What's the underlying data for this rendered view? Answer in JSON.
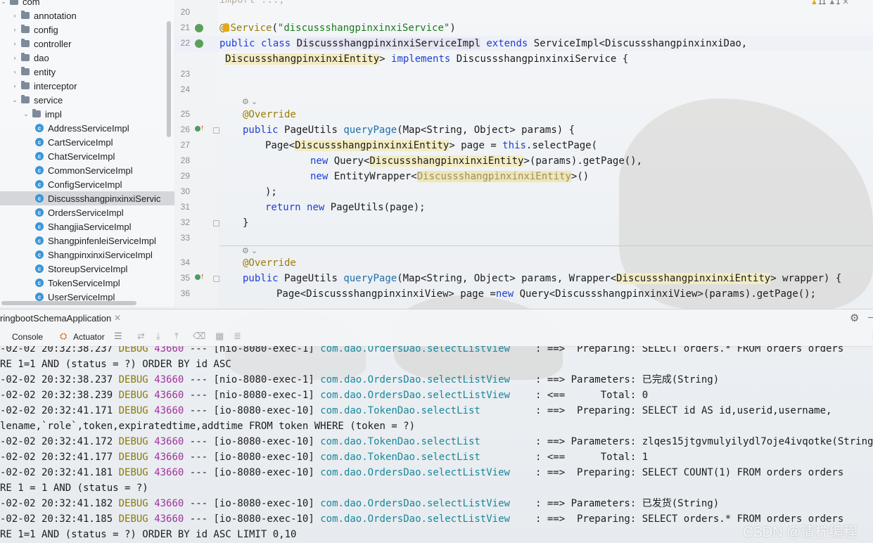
{
  "tree": {
    "items": [
      {
        "label": "com",
        "kind": "folder",
        "depth": 0,
        "expanded": true
      },
      {
        "label": "annotation",
        "kind": "folder",
        "depth": 1,
        "expanded": false
      },
      {
        "label": "config",
        "kind": "folder",
        "depth": 1,
        "expanded": false
      },
      {
        "label": "controller",
        "kind": "folder",
        "depth": 1,
        "expanded": false
      },
      {
        "label": "dao",
        "kind": "folder",
        "depth": 1,
        "expanded": false
      },
      {
        "label": "entity",
        "kind": "folder",
        "depth": 1,
        "expanded": false
      },
      {
        "label": "interceptor",
        "kind": "folder",
        "depth": 1,
        "expanded": false
      },
      {
        "label": "service",
        "kind": "folder",
        "depth": 1,
        "expanded": true
      },
      {
        "label": "impl",
        "kind": "folder",
        "depth": 2,
        "expanded": true
      },
      {
        "label": "AddressServiceImpl",
        "kind": "class",
        "depth": 3
      },
      {
        "label": "CartServiceImpl",
        "kind": "class",
        "depth": 3
      },
      {
        "label": "ChatServiceImpl",
        "kind": "class",
        "depth": 3
      },
      {
        "label": "CommonServiceImpl",
        "kind": "class",
        "depth": 3
      },
      {
        "label": "ConfigServiceImpl",
        "kind": "class",
        "depth": 3
      },
      {
        "label": "DiscussshangpinxinxiServic",
        "kind": "class",
        "depth": 3,
        "selected": true
      },
      {
        "label": "OrdersServiceImpl",
        "kind": "class",
        "depth": 3
      },
      {
        "label": "ShangjiaServiceImpl",
        "kind": "class",
        "depth": 3
      },
      {
        "label": "ShangpinfenleiServiceImpl",
        "kind": "class",
        "depth": 3
      },
      {
        "label": "ShangpinxinxiServiceImpl",
        "kind": "class",
        "depth": 3
      },
      {
        "label": "StoreupServiceImpl",
        "kind": "class",
        "depth": 3
      },
      {
        "label": "TokenServiceImpl",
        "kind": "class",
        "depth": 3
      },
      {
        "label": "UserServiceImpl",
        "kind": "class",
        "depth": 3
      }
    ]
  },
  "editor": {
    "line_numbers": [
      "20",
      "21",
      "22",
      "23",
      "24",
      "25",
      "26",
      "27",
      "28",
      "29",
      "30",
      "31",
      "32",
      "33",
      "34",
      "35",
      "36"
    ],
    "top_cut_text": "import ...;",
    "inspection": {
      "warnings": "11",
      "weak": "1"
    },
    "code": {
      "l21_at": "@",
      "l21_ann": "Service",
      "l21_open": "(",
      "l21_str": "\"discussshangpinxinxiService\"",
      "l21_close": ")",
      "l22_public": "public",
      "l22_class": "class",
      "l22_name": "DiscussshangpinxinxiServiceImpl",
      "l22_extends": "extends",
      "l22_base": "ServiceImpl<DiscussshangpinxinxiDao,",
      "l22b_entity": "DiscussshangpinxinxiEntity",
      "l22b_gt": ">",
      "l22b_implements": "implements",
      "l22b_rest": "DiscussshangpinxinxiService {",
      "l25": "@Override",
      "l26_public": "public",
      "l26_type": "PageUtils",
      "l26_fn": "queryPage",
      "l26_rest": "(Map<String, Object> params) {",
      "l27_a": "Page<",
      "l27_entity": "DiscussshangpinxinxiEntity",
      "l27_b": "> page = ",
      "l27_this": "this",
      "l27_c": ".selectPage(",
      "l28_new": "new",
      "l28_a": " Query<",
      "l28_entity": "DiscussshangpinxinxiEntity",
      "l28_b": ">(params).getPage(),",
      "l29_new": "new",
      "l29_a": " EntityWrapper<",
      "l29_entity": "DiscussshangpinxinxiEntity",
      "l29_b": ">()",
      "l30": ");",
      "l31_return": "return",
      "l31_new": "new",
      "l31_rest": "PageUtils(page);",
      "l32": "}",
      "l34": "@Override",
      "l35_public": "public",
      "l35_type": "PageUtils",
      "l35_fn": "queryPage",
      "l35_a": "(Map<String, Object> params, Wrapper<",
      "l35_entity": "DiscussshangpinxinxiEntity",
      "l35_b": "> wrapper) {",
      "l36_a": "Page<DiscussshangpinxinxiView> page =",
      "l36_new": "new",
      "l36_b": " Query<DiscussshangpinxinxiView>(params).getPage();"
    }
  },
  "run_panel": {
    "tab_label": "ringbootSchemaApplication",
    "tabs": [
      "Console",
      "Actuator"
    ],
    "lines": [
      {
        "ts": "-02-02 20:32:38.237",
        "lvl": "DEBUG",
        "pid": "43660",
        "thr": "--- [nio-8080-exec-1]",
        "logger": "com.dao.OrdersDao.selectListView",
        "msg": ": ==>  Preparing: SELECT orders.* FROM orders orders"
      },
      {
        "plain": "RE 1=1 AND (status = ?) ORDER BY id ASC"
      },
      {
        "ts": "-02-02 20:32:38.237",
        "lvl": "DEBUG",
        "pid": "43660",
        "thr": "--- [nio-8080-exec-1]",
        "logger": "com.dao.OrdersDao.selectListView",
        "msg": ": ==> Parameters: 已完成(String)"
      },
      {
        "ts": "-02-02 20:32:38.239",
        "lvl": "DEBUG",
        "pid": "43660",
        "thr": "--- [nio-8080-exec-1]",
        "logger": "com.dao.OrdersDao.selectListView",
        "msg": ": <==      Total: 0"
      },
      {
        "ts": "-02-02 20:32:41.171",
        "lvl": "DEBUG",
        "pid": "43660",
        "thr": "--- [io-8080-exec-10]",
        "logger": "com.dao.TokenDao.selectList",
        "msg": ": ==>  Preparing: SELECT id AS id,userid,username,"
      },
      {
        "plain": "lename,`role`,token,expiratedtime,addtime FROM token WHERE (token = ?)"
      },
      {
        "ts": "-02-02 20:32:41.172",
        "lvl": "DEBUG",
        "pid": "43660",
        "thr": "--- [io-8080-exec-10]",
        "logger": "com.dao.TokenDao.selectList",
        "msg": ": ==> Parameters: zlqes15jtgvmulyilydl7oje4ivqotke(String)"
      },
      {
        "ts": "-02-02 20:32:41.177",
        "lvl": "DEBUG",
        "pid": "43660",
        "thr": "--- [io-8080-exec-10]",
        "logger": "com.dao.TokenDao.selectList",
        "msg": ": <==      Total: 1"
      },
      {
        "ts": "-02-02 20:32:41.181",
        "lvl": "DEBUG",
        "pid": "43660",
        "thr": "--- [io-8080-exec-10]",
        "logger": "com.dao.OrdersDao.selectListView",
        "msg": ": ==>  Preparing: SELECT COUNT(1) FROM orders orders"
      },
      {
        "plain": "RE 1 = 1 AND (status = ?)"
      },
      {
        "ts": "-02-02 20:32:41.182",
        "lvl": "DEBUG",
        "pid": "43660",
        "thr": "--- [io-8080-exec-10]",
        "logger": "com.dao.OrdersDao.selectListView",
        "msg": ": ==> Parameters: 已发货(String)"
      },
      {
        "ts": "-02-02 20:32:41.185",
        "lvl": "DEBUG",
        "pid": "43660",
        "thr": "--- [io-8080-exec-10]",
        "logger": "com.dao.OrdersDao.selectListView",
        "msg": ": ==>  Preparing: SELECT orders.* FROM orders orders"
      },
      {
        "plain": "RE 1=1 AND (status = ?) ORDER BY id ASC LIMIT 0,10"
      }
    ]
  },
  "watermark": "CSDN @清柠编程",
  "colors": {
    "keyword": "#1d3fd6",
    "annotation": "#9b7c06",
    "string": "#1b7a1b",
    "debug": "#8a7a05",
    "pid": "#a2329b",
    "logger": "#19889a"
  }
}
